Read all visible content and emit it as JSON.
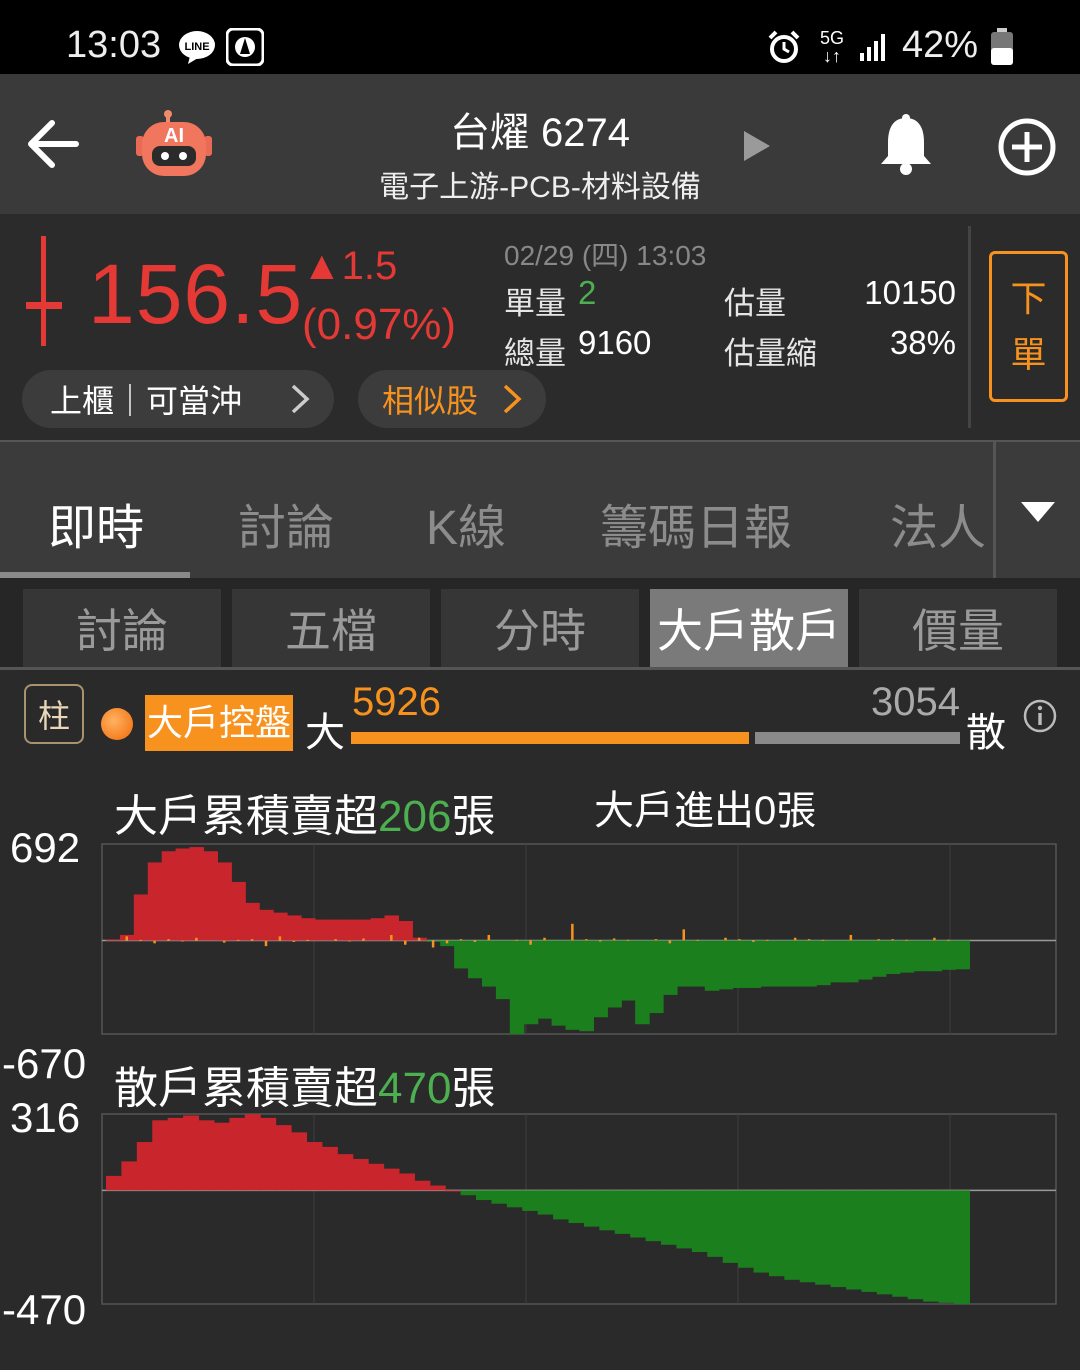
{
  "status_bar": {
    "time": "13:03",
    "battery_percent": "42%",
    "network": "5G",
    "icons": [
      "line-app-icon",
      "notification-app-icon",
      "alarm-icon",
      "5g-icon",
      "signal-icon",
      "battery-icon"
    ]
  },
  "header": {
    "title": "台燿 6274",
    "subtitle": "電子上游-PCB-材料設備",
    "ai_badge": "AI",
    "icons": [
      "back-arrow-icon",
      "ai-robot-icon",
      "play-icon",
      "bell-icon",
      "add-circle-icon"
    ]
  },
  "quote": {
    "price": "156.5",
    "change": "▲1.5",
    "change_pct": "(0.97%)",
    "datetime": "02/29 (四) 13:03",
    "single_volume_label": "單量",
    "single_volume": "2",
    "total_volume_label": "總量",
    "total_volume": "9160",
    "est_volume_label": "估量",
    "est_volume": "10150",
    "est_shrink_label": "估量縮",
    "est_shrink": "38%",
    "market_tag": "上櫃｜可當沖",
    "similar_label": "相似股",
    "order_label_1": "下",
    "order_label_2": "單",
    "colors": {
      "up": "#e53935",
      "accent": "#f7921e",
      "neutral": "#4caf50"
    }
  },
  "main_tabs": [
    {
      "label": "即時",
      "active": true
    },
    {
      "label": "討論",
      "active": false
    },
    {
      "label": "K線",
      "active": false
    },
    {
      "label": "籌碼日報",
      "active": false
    },
    {
      "label": "法人",
      "active": false
    }
  ],
  "sub_tabs": [
    {
      "label": "討論",
      "active": false
    },
    {
      "label": "五檔",
      "active": false
    },
    {
      "label": "分時",
      "active": false
    },
    {
      "label": "大戶散戶",
      "active": true
    },
    {
      "label": "價量",
      "active": false
    }
  ],
  "ratio": {
    "chip_label": "柱",
    "control_label": "大戶控盤",
    "big_label": "大",
    "big_value": 5926,
    "big_value_text": "5926",
    "small_value": 3054,
    "small_value_text": "3054",
    "small_label": "散"
  },
  "chart_data": [
    {
      "type": "bar",
      "title_prefix": "大戶累積賣超",
      "title_value": "206",
      "title_suffix": "張",
      "extra_prefix": "大戶進出",
      "extra_value": "0",
      "extra_suffix": "張",
      "ylim": [
        -670,
        692
      ],
      "ymax_label": "692",
      "ymin_label": "-670",
      "series": [
        {
          "name": "累積",
          "values": [
            8,
            40,
            330,
            560,
            640,
            660,
            670,
            640,
            560,
            420,
            270,
            220,
            200,
            180,
            160,
            150,
            150,
            150,
            150,
            160,
            180,
            140,
            20,
            -10,
            -40,
            -200,
            -270,
            -330,
            -420,
            -670,
            -600,
            -560,
            -610,
            -640,
            -650,
            -550,
            -480,
            -430,
            -600,
            -520,
            -390,
            -330,
            -330,
            -360,
            -350,
            -340,
            -340,
            -330,
            -330,
            -330,
            -330,
            -320,
            -300,
            -300,
            -280,
            -260,
            -240,
            -230,
            -220,
            -220,
            -210,
            -206
          ]
        },
        {
          "name": "進出",
          "values": [
            0,
            30,
            5,
            -20,
            10,
            -5,
            20,
            0,
            -15,
            5,
            10,
            -40,
            30,
            -10,
            5,
            0,
            10,
            -5,
            15,
            0,
            40,
            -30,
            20,
            -50,
            -20,
            10,
            -10,
            40,
            0,
            5,
            -30,
            20,
            0,
            120,
            10,
            -5,
            15,
            5,
            0,
            10,
            -20,
            80,
            5,
            0,
            20,
            10,
            -10,
            5,
            0,
            20,
            10,
            5,
            0,
            40,
            0,
            10,
            10,
            5,
            0,
            20,
            5,
            0
          ]
        }
      ]
    },
    {
      "type": "bar",
      "title_prefix": "散戶累積賣超",
      "title_value": "470",
      "title_suffix": "張",
      "ylim": [
        -470,
        316
      ],
      "ymax_label": "316",
      "ymin_label": "-470",
      "series": [
        {
          "name": "累積",
          "values": [
            60,
            120,
            200,
            290,
            300,
            310,
            290,
            280,
            300,
            315,
            300,
            270,
            240,
            200,
            180,
            150,
            130,
            110,
            90,
            70,
            40,
            20,
            0,
            -20,
            -40,
            -55,
            -70,
            -85,
            -100,
            -120,
            -135,
            -150,
            -165,
            -180,
            -195,
            -210,
            -225,
            -240,
            -255,
            -275,
            -300,
            -320,
            -340,
            -355,
            -370,
            -380,
            -390,
            -400,
            -410,
            -420,
            -430,
            -440,
            -450,
            -460,
            -465,
            -470
          ]
        }
      ]
    }
  ]
}
